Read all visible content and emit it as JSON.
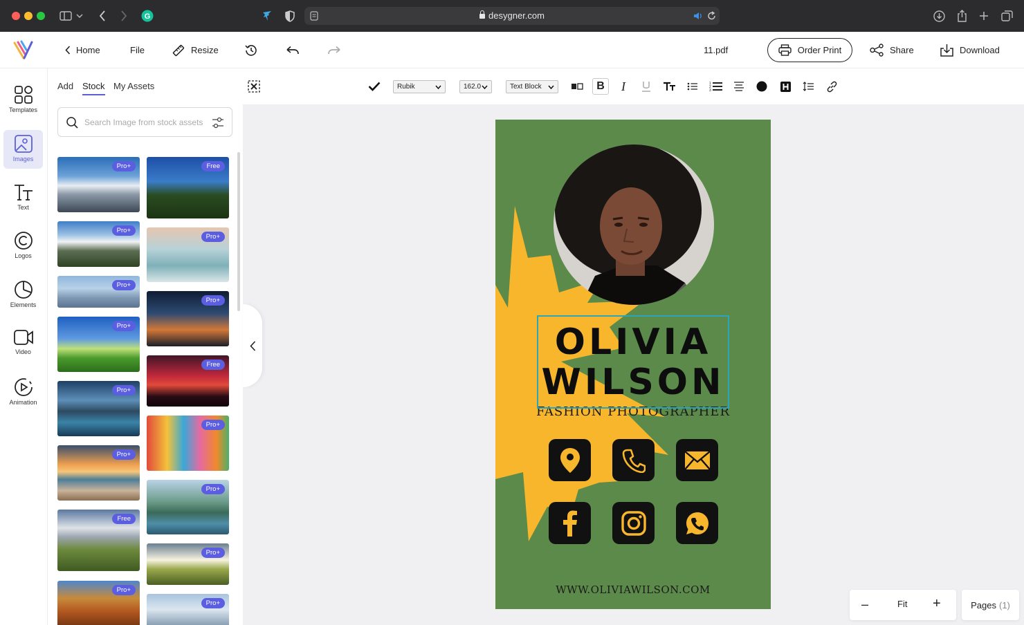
{
  "browser": {
    "url": "desygner.com",
    "colors": {
      "close": "#ff5f57",
      "minimize": "#febc2e",
      "zoom": "#28c840",
      "grammarly": "#15c39a"
    }
  },
  "toolbar": {
    "home_label": "Home",
    "file_label": "File",
    "resize_label": "Resize",
    "filename": "11.pdf",
    "order_print_label": "Order Print",
    "share_label": "Share",
    "download_label": "Download"
  },
  "rail": {
    "items": [
      {
        "label": "Templates",
        "icon": "templates-icon"
      },
      {
        "label": "Images",
        "icon": "images-icon",
        "active": true
      },
      {
        "label": "Text",
        "icon": "text-icon"
      },
      {
        "label": "Logos",
        "icon": "logos-icon"
      },
      {
        "label": "Elements",
        "icon": "elements-icon"
      },
      {
        "label": "Video",
        "icon": "video-icon"
      },
      {
        "label": "Animation",
        "icon": "animation-icon"
      }
    ]
  },
  "panel": {
    "tabs": [
      "Add",
      "Stock",
      "My Assets"
    ],
    "active_tab": "Stock",
    "search_placeholder": "Search Image from stock assets",
    "images_left": [
      {
        "badge": "Pro+",
        "scene": "snowy-mountains"
      },
      {
        "badge": "Pro+",
        "scene": "mountain-valley-road"
      },
      {
        "badge": "Pro+",
        "scene": "misty-hills"
      },
      {
        "badge": "Pro+",
        "scene": "green-field-blue-sky"
      },
      {
        "badge": "Pro+",
        "scene": "mountain-lake-reflection"
      },
      {
        "badge": "Pro+",
        "scene": "sunset-beach-waves"
      },
      {
        "badge": "Free",
        "scene": "cloudy-hillside"
      },
      {
        "badge": "Pro+",
        "scene": "autumn-forest"
      }
    ],
    "images_right": [
      {
        "badge": "Free",
        "scene": "lone-tree"
      },
      {
        "badge": "Pro+",
        "scene": "frosty-grass"
      },
      {
        "badge": "Pro+",
        "scene": "city-light-trails"
      },
      {
        "badge": "Free",
        "scene": "red-sky-tree"
      },
      {
        "badge": "Pro+",
        "scene": "colorful-canal-houses"
      },
      {
        "badge": "Pro+",
        "scene": "alpine-lake"
      },
      {
        "badge": "Pro+",
        "scene": "sunlit-meadow"
      },
      {
        "badge": "Pro+",
        "scene": "clouds-above-mountains"
      }
    ],
    "badge_color": "#5b5ee0"
  },
  "format": {
    "font": "Rubik",
    "size": "162.0",
    "block_type": "Text Block"
  },
  "card": {
    "name_line1": "OLIVIA",
    "name_line2": "WILSON",
    "role": "FASHION PHOTOGRAPHER",
    "website": "WWW.OLIVIAWILSON.COM",
    "bg_color": "#5b8a4a",
    "burst_color": "#f7b62b",
    "contacts": [
      "location-pin-icon",
      "phone-icon",
      "email-icon",
      "facebook-icon",
      "instagram-icon",
      "whatsapp-icon"
    ]
  },
  "zoom": {
    "minus": "–",
    "fit_label": "Fit",
    "plus": "+"
  },
  "pages": {
    "label": "Pages",
    "count": "(1)"
  }
}
